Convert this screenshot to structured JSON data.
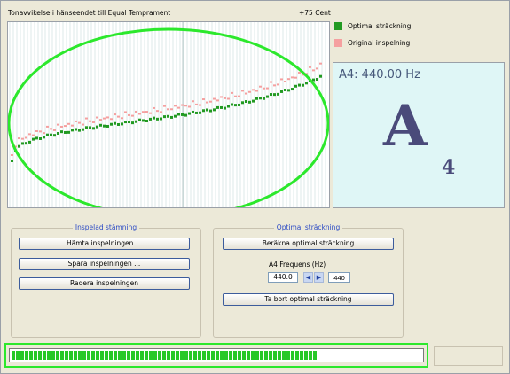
{
  "chart": {
    "title": "Tonavvikelse i hänseendet till Equal Temprament",
    "cent_label": "+75 Cent"
  },
  "legend": {
    "optimal": {
      "label": "Optimal sträckning",
      "color": "#229a22"
    },
    "original": {
      "label": "Original inspelning",
      "color": "#f5a0a0"
    }
  },
  "note": {
    "frequency": "A4: 440.00 Hz",
    "letter": "A",
    "octave": "4"
  },
  "recorded": {
    "title": "Inspelad stämning",
    "fetch": "Hämta inspelningen ...",
    "save": "Spara inspelningen ...",
    "delete": "Radera inspelningen"
  },
  "optimal": {
    "title": "Optimal sträckning",
    "compute": "Beräkna optimal sträckning",
    "freq_label": "A4 Frequens (Hz)",
    "freq_value": "440.0",
    "freq_input": "440",
    "remove": "Ta bort optimal sträckning"
  },
  "progress": {
    "value": 0.74
  },
  "colors": {
    "background": "#ece9d8",
    "highlight": "#2ce82c",
    "button_border": "#3c5c9c"
  }
}
